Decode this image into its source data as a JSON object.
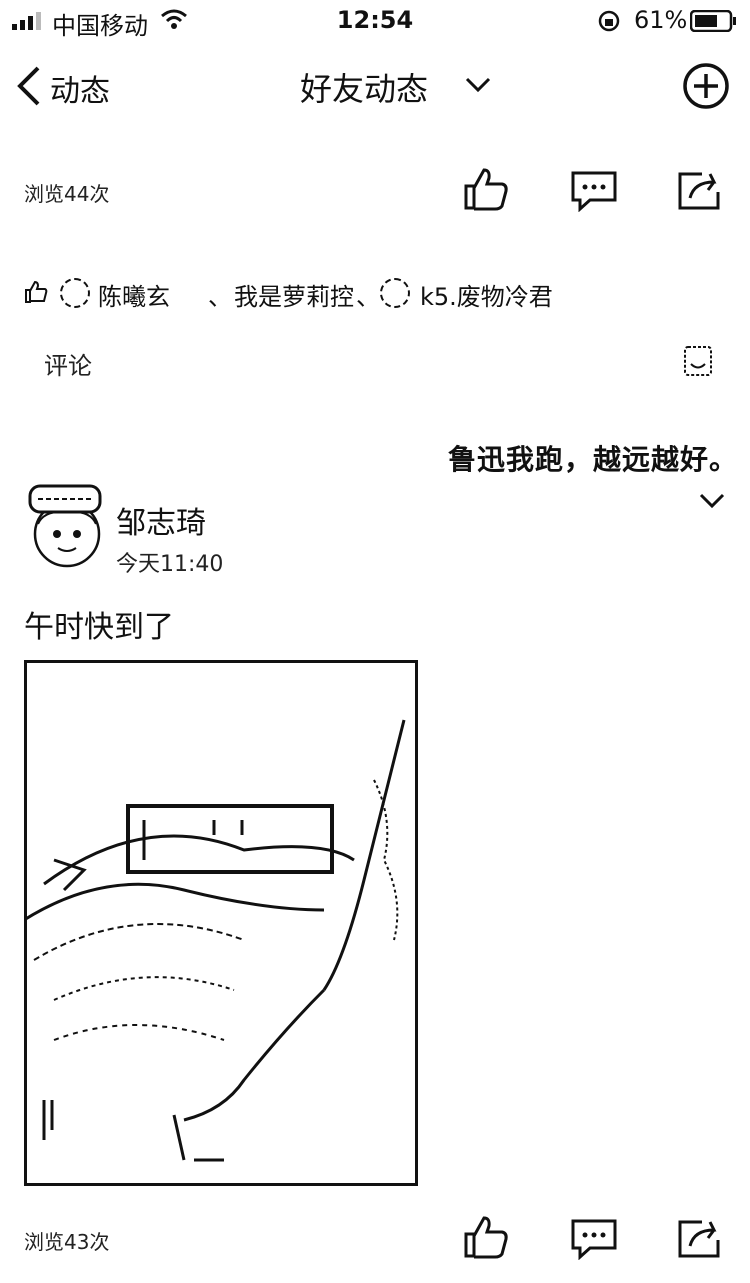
{
  "status_bar": {
    "carrier": "中国移动",
    "time": "12:54",
    "battery": "61%"
  },
  "nav": {
    "back_label": "动态",
    "title": "好友动态"
  },
  "post1": {
    "views": "浏览44次",
    "likes_names": [
      "陈曦玄",
      "我是萝莉控",
      "k5.废物冷君"
    ],
    "likes_sep": "、",
    "comment_label": "评论"
  },
  "post2": {
    "quote": "鲁迅我跑，越远越好。",
    "author": "邹志琦",
    "time": "今天11:40",
    "text": "午时快到了",
    "views": "浏览43次"
  },
  "colors": {
    "text": "#111111",
    "background": "#ffffff"
  }
}
